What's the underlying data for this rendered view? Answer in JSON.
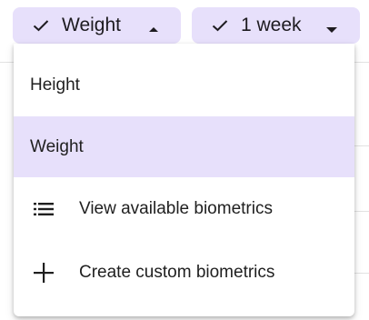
{
  "filters": {
    "metric_chip": {
      "label": "Weight",
      "checked_icon": "check-icon",
      "arrow_icon": "arrow-up-icon"
    },
    "range_chip": {
      "label": "1 week",
      "checked_icon": "check-icon",
      "arrow_icon": "arrow-down-icon"
    }
  },
  "menu": {
    "options": [
      {
        "label": "Height",
        "selected": false
      },
      {
        "label": "Weight",
        "selected": true
      }
    ],
    "actions": [
      {
        "label": "View available biometrics",
        "icon": "list-icon"
      },
      {
        "label": "Create custom biometrics",
        "icon": "plus-icon"
      }
    ]
  },
  "colors": {
    "chip_bg": "#e7e0fb",
    "selected_bg": "#e7e0fb"
  }
}
